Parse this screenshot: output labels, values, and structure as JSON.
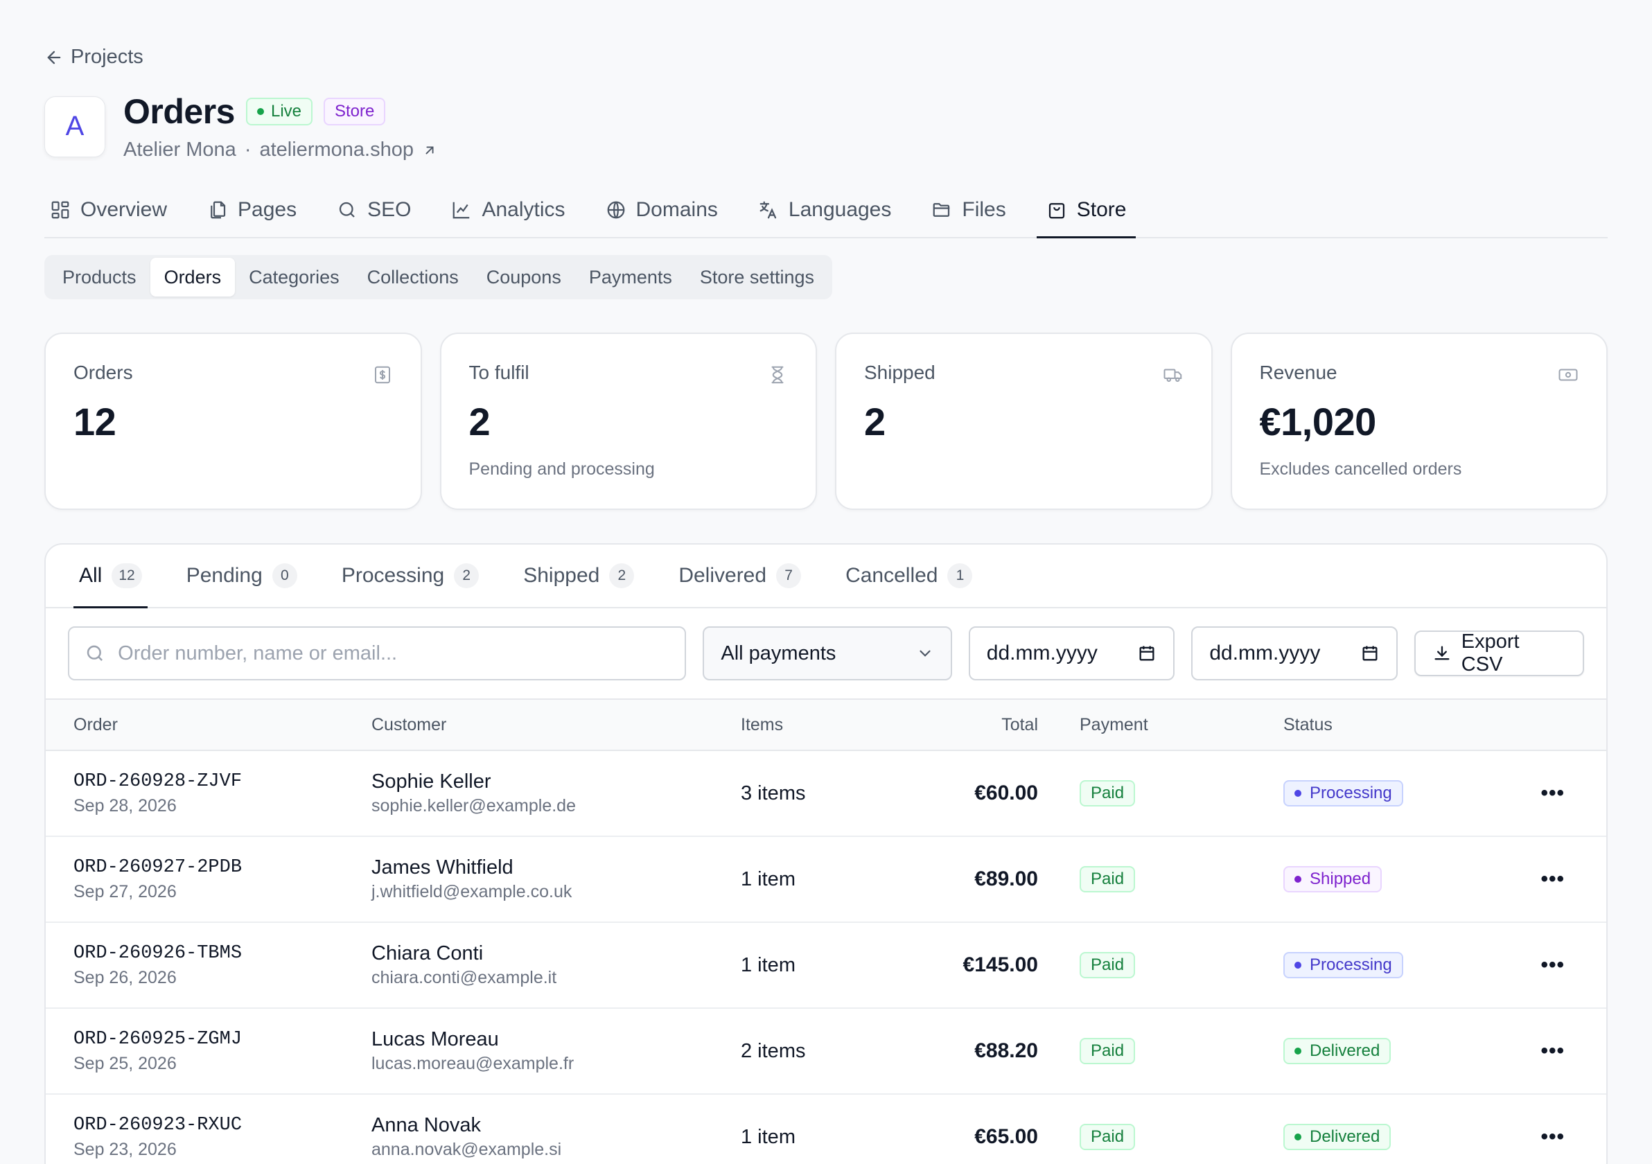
{
  "back": {
    "label": "Projects"
  },
  "project": {
    "logo_letter": "A",
    "title": "Orders",
    "badge_live": "Live",
    "badge_type": "Store",
    "owner": "Atelier Mona",
    "separator": "·",
    "domain": "ateliermona.shop"
  },
  "main_nav": [
    {
      "label": "Overview",
      "icon": "grid-icon"
    },
    {
      "label": "Pages",
      "icon": "pages-icon"
    },
    {
      "label": "SEO",
      "icon": "search-icon"
    },
    {
      "label": "Analytics",
      "icon": "chart-icon"
    },
    {
      "label": "Domains",
      "icon": "globe-icon"
    },
    {
      "label": "Languages",
      "icon": "translate-icon"
    },
    {
      "label": "Files",
      "icon": "folder-icon"
    },
    {
      "label": "Store",
      "icon": "bag-icon",
      "active": true
    }
  ],
  "sub_nav": [
    "Products",
    "Orders",
    "Categories",
    "Collections",
    "Coupons",
    "Payments",
    "Store settings"
  ],
  "stats": [
    {
      "label": "Orders",
      "value": "12",
      "note": "",
      "icon": "dollar-receipt-icon"
    },
    {
      "label": "To fulfil",
      "value": "2",
      "note": "Pending and processing",
      "icon": "hourglass-icon"
    },
    {
      "label": "Shipped",
      "value": "2",
      "note": "",
      "icon": "truck-icon"
    },
    {
      "label": "Revenue",
      "value": "€1,020",
      "note": "Excludes cancelled orders",
      "icon": "banknote-icon"
    }
  ],
  "status_tabs": [
    {
      "label": "All",
      "count": "12",
      "active": true
    },
    {
      "label": "Pending",
      "count": "0"
    },
    {
      "label": "Processing",
      "count": "2"
    },
    {
      "label": "Shipped",
      "count": "2"
    },
    {
      "label": "Delivered",
      "count": "7"
    },
    {
      "label": "Cancelled",
      "count": "1"
    }
  ],
  "filters": {
    "search_placeholder": "Order number, name or email...",
    "payment_select": "All payments",
    "date_from": "dd.mm.yyyy",
    "date_to": "dd.mm.yyyy",
    "export_label": "Export CSV"
  },
  "table": {
    "headers": {
      "order": "Order",
      "customer": "Customer",
      "items": "Items",
      "total": "Total",
      "payment": "Payment",
      "status": "Status"
    },
    "rows": [
      {
        "id": "ORD-260928-ZJVF",
        "date": "Sep 28, 2026",
        "name": "Sophie Keller",
        "email": "sophie.keller@example.de",
        "items": "3 items",
        "total": "€60.00",
        "payment": "Paid",
        "status": "Processing",
        "status_kind": "processing",
        "actions": "•••"
      },
      {
        "id": "ORD-260927-2PDB",
        "date": "Sep 27, 2026",
        "name": "James Whitfield",
        "email": "j.whitfield@example.co.uk",
        "items": "1 item",
        "total": "€89.00",
        "payment": "Paid",
        "status": "Shipped",
        "status_kind": "shipped",
        "actions": "•••"
      },
      {
        "id": "ORD-260926-TBMS",
        "date": "Sep 26, 2026",
        "name": "Chiara Conti",
        "email": "chiara.conti@example.it",
        "items": "1 item",
        "total": "€145.00",
        "payment": "Paid",
        "status": "Processing",
        "status_kind": "processing",
        "actions": "•••"
      },
      {
        "id": "ORD-260925-ZGMJ",
        "date": "Sep 25, 2026",
        "name": "Lucas Moreau",
        "email": "lucas.moreau@example.fr",
        "items": "2 items",
        "total": "€88.20",
        "payment": "Paid",
        "status": "Delivered",
        "status_kind": "delivered",
        "actions": "•••"
      },
      {
        "id": "ORD-260923-RXUC",
        "date": "Sep 23, 2026",
        "name": "Anna Novak",
        "email": "anna.novak@example.si",
        "items": "1 item",
        "total": "€65.00",
        "payment": "Paid",
        "status": "Delivered",
        "status_kind": "delivered",
        "actions": "•••"
      }
    ]
  },
  "colors": {
    "accent": "#4f46e5",
    "live_green": "#15803d",
    "store_purple": "#7e22ce"
  }
}
